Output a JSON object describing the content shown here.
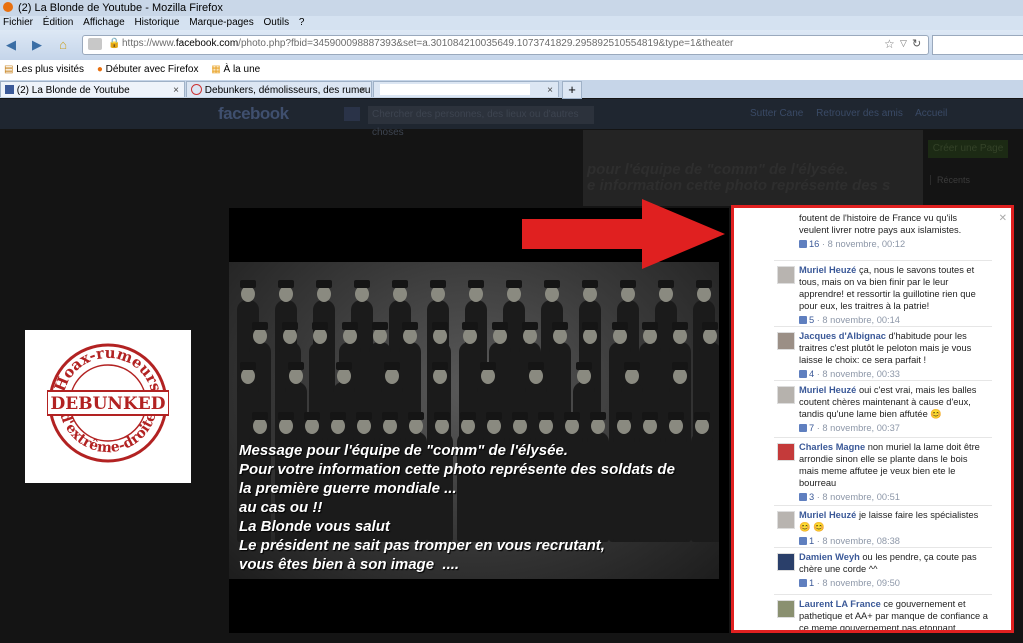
{
  "window": {
    "title": "(2) La Blonde de Youtube - Mozilla Firefox"
  },
  "menu": [
    "Fichier",
    "Édition",
    "Affichage",
    "Historique",
    "Marque-pages",
    "Outils",
    "?"
  ],
  "address": {
    "prefix": "https://www.",
    "domain": "facebook.com",
    "path": "/photo.php?fbid=345900098887393&set=a.301084210035649.1073741829.295892510554819&type=1&theater"
  },
  "bookmarks": [
    "Les plus visités",
    "Débuter avec Firefox",
    "À la une"
  ],
  "tabs": [
    {
      "label": "(2) La Blonde de Youtube"
    },
    {
      "label": "Debunkers, démolisseurs, des rumeur..."
    },
    {
      "label": ""
    }
  ],
  "facebook": {
    "logo": "facebook",
    "search_placeholder": "Chercher des personnes, des lieux ou d'autres choses",
    "nav": [
      "Sutter Cane",
      "Retrouver des amis",
      "Accueil"
    ],
    "create_page": "Créer une Page",
    "recents": "Récents"
  },
  "bg_photo_text": "pour l'équipe de \"comm\" de l'élysée.\ne information cette photo représente des s",
  "photo_caption": "Message pour l'équipe de \"comm\" de l'élysée.\nPour votre information cette photo représente des soldats de\nla première guerre mondiale ...\nau cas ou !!\nLa Blonde vous salut\nLe président ne sait pas tromper en vous recrutant,\nvous êtes bien à son image  ....",
  "stamp": {
    "top_text": "Hoax-rumeurs",
    "center_text": "DEBUNKED",
    "bottom_text": "d'extrême-droite",
    "color": "#b22222"
  },
  "arrow_color": "#e02020",
  "highlight_color": "#e02020",
  "comments": [
    {
      "author": "",
      "text": "foutent de l'histoire de France vu qu'ils veulent livrer notre pays aux islamistes.",
      "likes": "16",
      "date": "8 novembre, 00:12"
    },
    {
      "author": "Muriel Heuzé",
      "text": "ça, nous le savons toutes et tous, mais on va bien finir par le leur apprendre! et ressortir la guillotine rien que pour eux, les traitres à la patrie!",
      "likes": "5",
      "date": "8 novembre, 00:14"
    },
    {
      "author": "Jacques d'Albignac",
      "text": "d'habitude pour les traitres c'est plutôt le peloton mais je vous laisse le choix: ce sera parfait !",
      "likes": "4",
      "date": "8 novembre, 00:33"
    },
    {
      "author": "Muriel Heuzé",
      "text": "oui c'est vrai, mais les balles coutent chères maintenant à cause d'eux, tandis qu'une lame bien affutée 😊",
      "likes": "7",
      "date": "8 novembre, 00:37"
    },
    {
      "author": "Charles Magne",
      "text": "non muriel la lame doit être arrondie sinon elle se plante dans le bois mais meme affutee je veux bien ete le bourreau",
      "likes": "3",
      "date": "8 novembre, 00:51"
    },
    {
      "author": "Muriel Heuzé",
      "text": "je laisse faire les spécialistes 😊 😊",
      "likes": "1",
      "date": "8 novembre, 08:38"
    },
    {
      "author": "Damien Weyh",
      "text": "ou les pendre, ça coute pas chère une corde ^^",
      "likes": "1",
      "date": "8 novembre, 09:50"
    },
    {
      "author": "Laurent LA France",
      "text": "ce gouvernement et pathetique et AA+ par manque de confiance a ce meme gouvernement pas etonnant",
      "likes": "",
      "date": ""
    }
  ]
}
